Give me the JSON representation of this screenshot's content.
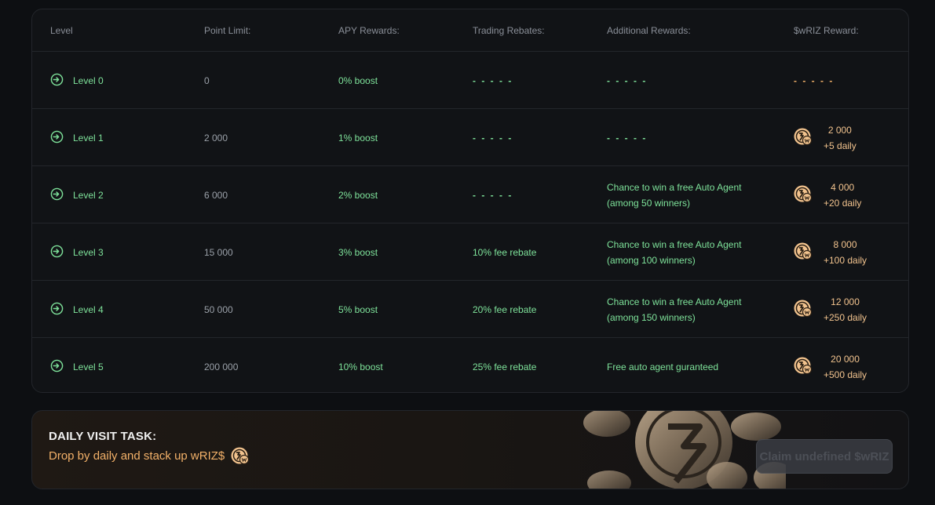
{
  "table": {
    "headers": {
      "level": "Level",
      "point_limit": "Point Limit:",
      "apy": "APY Rewards:",
      "trading": "Trading Rebates:",
      "additional": "Additional Rewards:",
      "wriz": "$wRIZ Reward:"
    },
    "rows": [
      {
        "level": "Level 0",
        "points": "0",
        "apy": "0% boost",
        "trading": "- - - - -",
        "additional_1": "- - - - -",
        "additional_2": "",
        "wriz_dash": "- - - - -",
        "wriz_amount": "",
        "wriz_daily": ""
      },
      {
        "level": "Level 1",
        "points": "2 000",
        "apy": "1% boost",
        "trading": "- - - - -",
        "additional_1": "- - - - -",
        "additional_2": "",
        "wriz_dash": "",
        "wriz_amount": "2 000",
        "wriz_daily": "+5 daily"
      },
      {
        "level": "Level 2",
        "points": "6 000",
        "apy": "2% boost",
        "trading": "- - - - -",
        "additional_1": "Chance to win a free Auto Agent",
        "additional_2": "(among 50 winners)",
        "wriz_dash": "",
        "wriz_amount": "4 000",
        "wriz_daily": "+20 daily"
      },
      {
        "level": "Level 3",
        "points": "15 000",
        "apy": "3% boost",
        "trading": "10% fee rebate",
        "additional_1": "Chance to win a free Auto Agent",
        "additional_2": "(among 100 winners)",
        "wriz_dash": "",
        "wriz_amount": "8 000",
        "wriz_daily": "+100 daily"
      },
      {
        "level": "Level 4",
        "points": "50 000",
        "apy": "5% boost",
        "trading": "20% fee rebate",
        "additional_1": "Chance to win a free Auto Agent",
        "additional_2": "(among 150 winners)",
        "wriz_dash": "",
        "wriz_amount": "12 000",
        "wriz_daily": "+250 daily"
      },
      {
        "level": "Level 5",
        "points": "200 000",
        "apy": "10% boost",
        "trading": "25% fee rebate",
        "additional_1": "Free auto agent guranteed",
        "additional_2": "",
        "wriz_dash": "",
        "wriz_amount": "20 000",
        "wriz_daily": "+500 daily"
      }
    ]
  },
  "task": {
    "title": "DAILY VISIT TASK:",
    "subtitle": "Drop by daily and stack up wRIZ$",
    "claim_label": "Claim undefined $wRIZ"
  },
  "icons": {
    "level": "enter-arrow-icon",
    "reward": "wriz-coin-icon"
  },
  "colors": {
    "green": "#7ee29a",
    "orange": "#f3b169",
    "background": "#0d0f12",
    "card": "#111316"
  }
}
